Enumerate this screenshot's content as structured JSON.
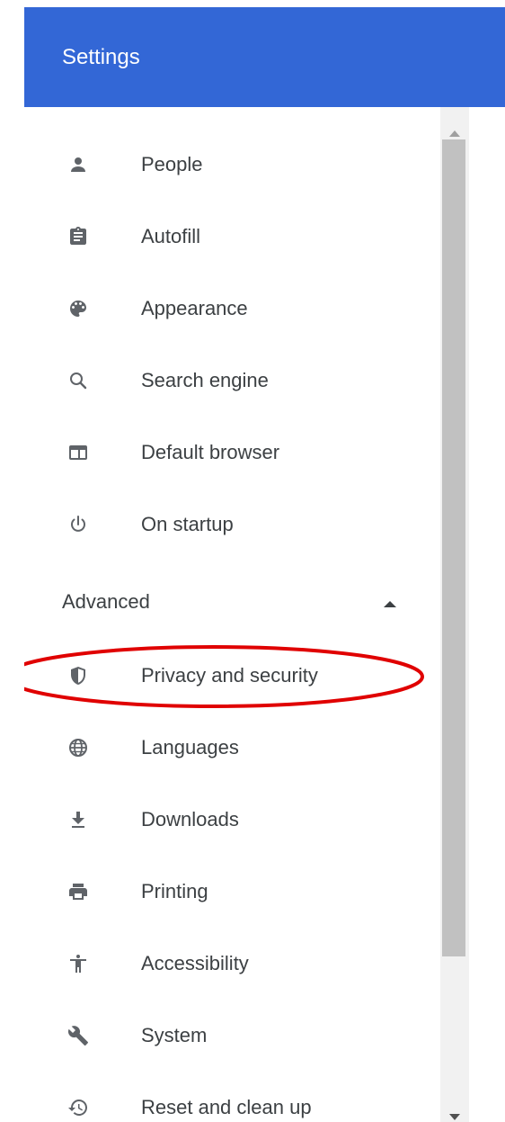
{
  "header": {
    "title": "Settings"
  },
  "menu": {
    "items": [
      {
        "label": "People",
        "icon": "person-icon"
      },
      {
        "label": "Autofill",
        "icon": "clipboard-icon"
      },
      {
        "label": "Appearance",
        "icon": "palette-icon"
      },
      {
        "label": "Search engine",
        "icon": "search-icon"
      },
      {
        "label": "Default browser",
        "icon": "browser-window-icon"
      },
      {
        "label": "On startup",
        "icon": "power-icon"
      }
    ],
    "advanced": {
      "label": "Advanced",
      "expanded": true,
      "items": [
        {
          "label": "Privacy and security",
          "icon": "shield-icon",
          "highlighted": true
        },
        {
          "label": "Languages",
          "icon": "globe-icon"
        },
        {
          "label": "Downloads",
          "icon": "download-icon"
        },
        {
          "label": "Printing",
          "icon": "printer-icon"
        },
        {
          "label": "Accessibility",
          "icon": "accessibility-icon"
        },
        {
          "label": "System",
          "icon": "wrench-icon"
        },
        {
          "label": "Reset and clean up",
          "icon": "restore-icon"
        }
      ]
    }
  },
  "colors": {
    "header_bg": "#3367d6",
    "header_text": "#ffffff",
    "menu_text": "#3c4043",
    "icon": "#5f6368",
    "highlight_ring": "#e00000",
    "scrollbar_track": "#f1f1f1",
    "scrollbar_thumb": "#c1c1c1"
  }
}
